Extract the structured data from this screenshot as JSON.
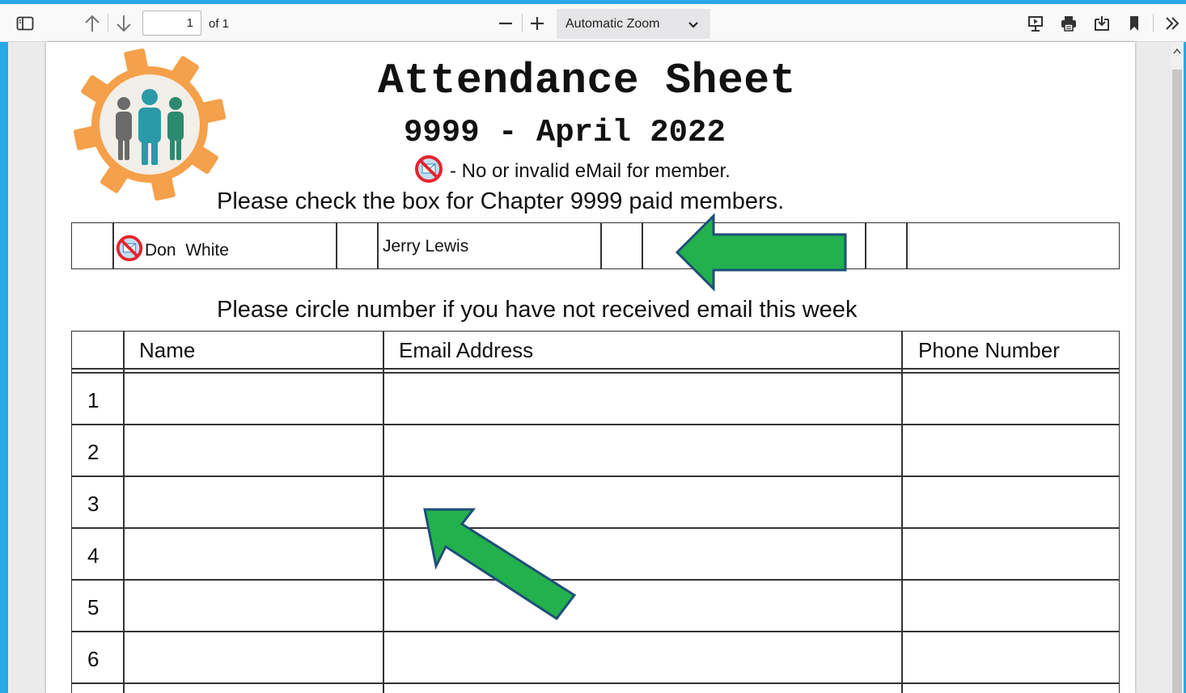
{
  "toolbar": {
    "page_number": "1",
    "page_count": "of 1",
    "zoom": "Automatic Zoom"
  },
  "document": {
    "title": "Attendance Sheet",
    "subtitle": "9999 - April 2022",
    "legend_text": "- No or invalid eMail for member.",
    "paid_instruction": "Please check the box for  Chapter 9999 paid members.",
    "members": [
      {
        "name": "Don  White",
        "no_email": true
      },
      {
        "name": "Jerry Lewis",
        "no_email": false
      }
    ],
    "email_instruction": "Please circle number if you have not received email this week",
    "columns": [
      "Name",
      "Email Address",
      "Phone Number"
    ],
    "rows": [
      "1",
      "2",
      "3",
      "4",
      "5",
      "6"
    ]
  },
  "colors": {
    "accent": "#29a9e6",
    "arrow_fill": "#22b14c",
    "arrow_stroke": "#1f4e79",
    "logo_gear": "#f5a04a",
    "no_email_icon": "#e8232d"
  },
  "icons": [
    "sidebar-toggle-icon",
    "arrow-up-icon",
    "arrow-down-icon",
    "zoom-out-icon",
    "zoom-in-icon",
    "chevron-down-icon",
    "presentation-icon",
    "print-icon",
    "save-icon",
    "bookmark-icon",
    "tools-chevron-icon",
    "no-email-icon",
    "team-gear-logo"
  ]
}
